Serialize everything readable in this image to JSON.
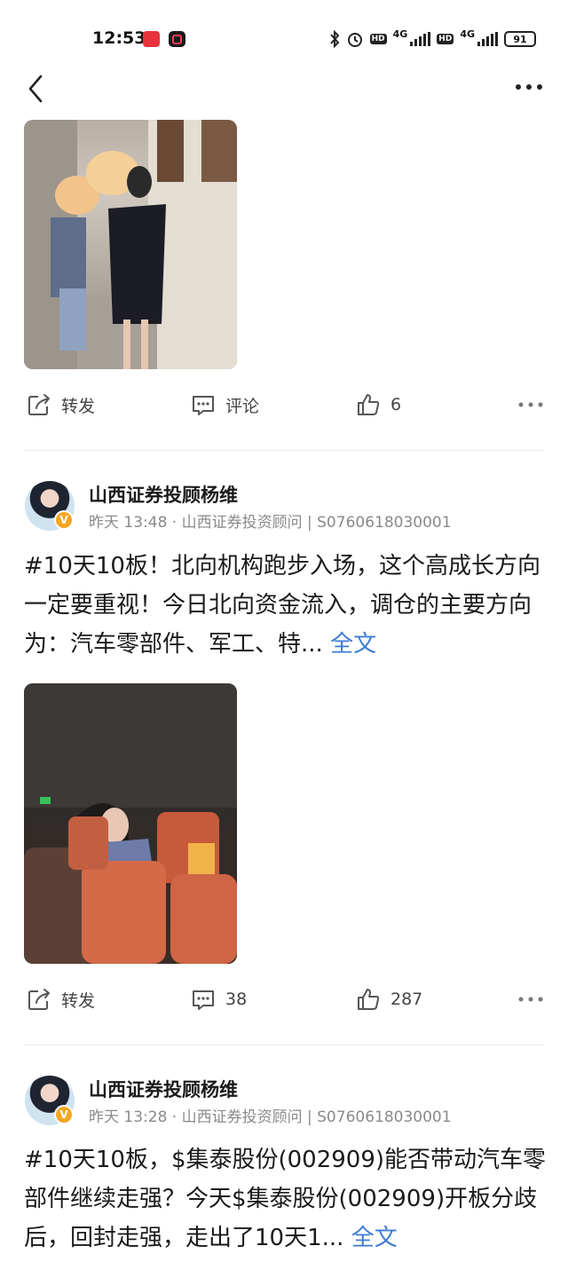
{
  "status_bar": {
    "time": "12:53",
    "battery": "91",
    "net1": "4G",
    "net2": "4G",
    "hd": "HD"
  },
  "posts": [
    {
      "image": "post-photo",
      "actions": {
        "repost": "转发",
        "comment": "评论",
        "likes": "6"
      }
    },
    {
      "author": "山西证券投顾杨维",
      "badge": "V",
      "meta": "昨天 13:48 · 山西证券投资顾问 | S0760618030001",
      "text": "#10天10板！北向机构跑步入场，这个高成长方向一定要重视！今日北向资金流入，调仓的主要方向为：汽车零部件、军工、特...",
      "more": "全文",
      "image": "post-photo",
      "actions": {
        "repost": "转发",
        "comment": "38",
        "likes": "287"
      }
    },
    {
      "author": "山西证券投顾杨维",
      "badge": "V",
      "meta": "昨天 13:28 · 山西证券投资顾问 | S0760618030001",
      "text": "#10天10板，$集泰股份(002909)能否带动汽车零部件继续走强？今天$集泰股份(002909)开板分歧后，回封走强，走出了10天1...",
      "more": "全文"
    }
  ],
  "icons": [
    "back-arrow-icon",
    "more-dots-icon",
    "repost-icon",
    "comment-icon",
    "thumbs-up-icon"
  ],
  "colors": {
    "link": "#3d7bd2",
    "badge": "#f5a623",
    "meta": "#8a8a8a"
  }
}
